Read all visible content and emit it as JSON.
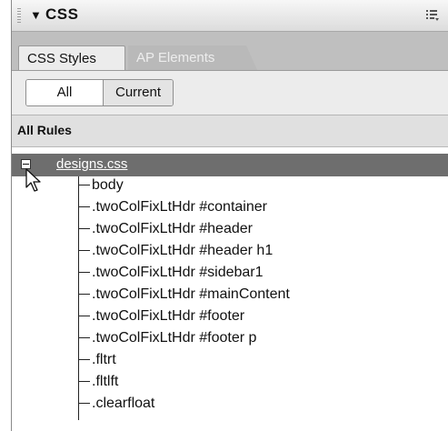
{
  "panel": {
    "title": "CSS",
    "title_arrow": "▼",
    "options_icon": "panel-options-icon"
  },
  "tabs": [
    {
      "label": "CSS Styles",
      "active": true
    },
    {
      "label": "AP Elements",
      "active": false
    }
  ],
  "toggle": {
    "all_label": "All",
    "current_label": "Current",
    "selected": "All"
  },
  "section": {
    "header": "All Rules"
  },
  "tree": {
    "file": "designs.css",
    "expanded": true,
    "rules": [
      "body",
      ".twoColFixLtHdr #container",
      ".twoColFixLtHdr #header",
      ".twoColFixLtHdr #header h1",
      ".twoColFixLtHdr #sidebar1",
      ".twoColFixLtHdr #mainContent",
      ".twoColFixLtHdr #footer",
      ".twoColFixLtHdr #footer p",
      ".fltrt",
      ".fltlft",
      ".clearfloat"
    ]
  },
  "colors": {
    "selected_row": "#6e6e6e",
    "tab_strip": "#bfbfbf",
    "panel_bg": "#ececec"
  }
}
